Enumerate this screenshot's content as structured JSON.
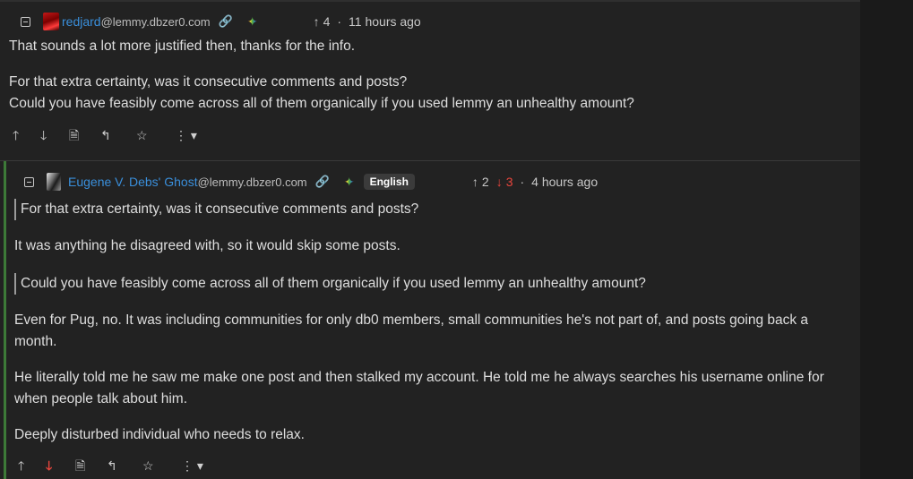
{
  "comment1": {
    "username": "redjard",
    "instance": "@lemmy.dbzer0.com",
    "score_icon": "arrow-up-icon",
    "score": "4",
    "timestamp": "11 hours ago",
    "paragraphs": [
      "That sounds a lot more justified then, thanks for the info.",
      "For that extra certainty, was it consecutive comments and posts?",
      "Could you have feasibly come across all of them organically if you used lemmy an unhealthy amount?"
    ]
  },
  "comment2": {
    "username": "Eugene V. Debs' Ghost",
    "instance": "@lemmy.dbzer0.com",
    "language": "English",
    "upvotes": "2",
    "downvotes": "3",
    "timestamp": "4 hours ago",
    "quote1": "For that extra certainty, was it consecutive comments and posts?",
    "para1": "It was anything he disagreed with, so it would skip some posts.",
    "quote2": "Could you have feasibly come across all of them organically if you used lemmy an unhealthy amount?",
    "para2_line1": "Even for Pug, no. It was including communities for only db0 members, small communities he's not part of, and posts going back a",
    "para2_line2": "month.",
    "para3_line1": "He literally told me he saw me make one post and then stalked my account. He told me he always searches his username online for",
    "para3_line2": "when people talk about him.",
    "para4": "Deeply disturbed individual who needs to relax."
  },
  "glyphs": {
    "up": "🡑",
    "down": "🡓",
    "score_up": "↑",
    "score_down": "↓",
    "source": "🗎",
    "reply": "↰",
    "star": "☆",
    "more": "⋮ ▾",
    "link": "🔗",
    "separator": "·"
  },
  "colors": {
    "background": "#222222",
    "username": "#3a8fdb",
    "downvote_active": "#e8453c",
    "thread_bar": "#3d7a38"
  }
}
